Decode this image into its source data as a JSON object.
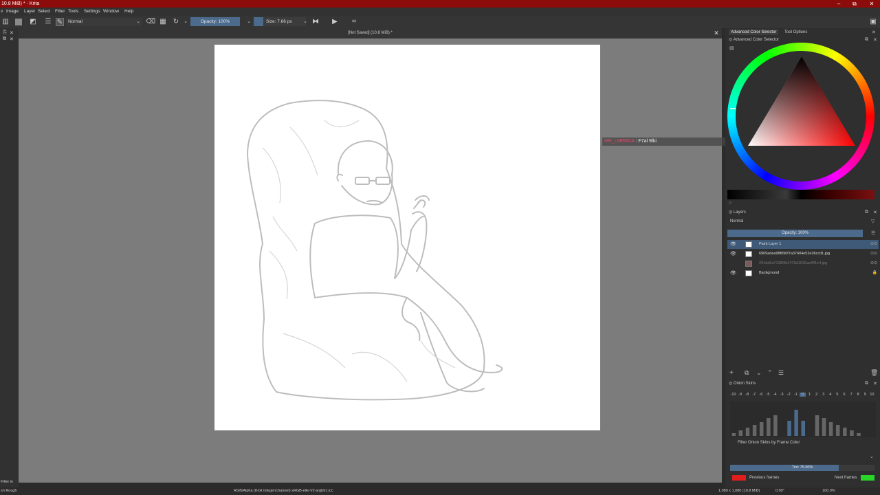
{
  "window": {
    "title": "10.8 MiB) * - Krita",
    "controls": [
      "–",
      "⧉",
      "✕"
    ]
  },
  "menu": [
    "v",
    "Image",
    "Layer",
    "Select",
    "Filter",
    "Tools",
    "Settings",
    "Window",
    "Help"
  ],
  "toolbar": {
    "blend_mode": "Normal",
    "opacity_label": "Opacity: 100%",
    "size_label": "Size: 7.66 px"
  },
  "document": {
    "tab_title": "[Not Saved]  (10.8 MiB) *"
  },
  "chat": {
    "user": "MR_LMERDA",
    "separator": " : ",
    "message": "F7al 9lbi"
  },
  "dock": {
    "tabs": [
      "Advanced Color Selector",
      "Tool Options"
    ],
    "color_panel_title": "Advanced Color Selector",
    "layers_title": "Layers",
    "layers_blend": "Normal",
    "layers_opacity": "Opacity: 100%",
    "layers": [
      {
        "name": "Paint Layer 1",
        "visible": true,
        "active": true
      },
      {
        "name": "6909adea98f090f7a37404e52e36ccd1.jpg",
        "visible": true,
        "active": false
      },
      {
        "name": "291dd6a713f59b2479d1616aa4ff1e4.jpg",
        "visible": false,
        "active": false
      },
      {
        "name": "Background",
        "visible": true,
        "active": false
      }
    ],
    "onion_title": "Onion Skins",
    "onion_numbers": [
      "-10",
      "-9",
      "-8",
      "-7",
      "-6",
      "-5",
      "-4",
      "-3",
      "-2",
      "-1",
      "0",
      "1",
      "2",
      "3",
      "4",
      "5",
      "6",
      "7",
      "8",
      "9",
      "10"
    ],
    "onion_filter_label": "Filter Onion Skins by Frame Color",
    "tint_label": "Tint: 75.00%",
    "tint_fraction": 0.75,
    "previous_frames_label": "Previous frames",
    "next_frames_label": "Next frames",
    "previous_color": "#e11d1d",
    "next_color": "#27d627"
  },
  "statusbar": {
    "left": "sh Rough",
    "filter_label": "Filter in",
    "color_info": "RGB/Alpha (8-bit integer/channel)  sRGB-elle-V2-srgbtrc.icc",
    "image_info": "1,080 x 1,080 (10.8 MiB)",
    "rotation": "0.00°",
    "zoom": "100.0%"
  }
}
